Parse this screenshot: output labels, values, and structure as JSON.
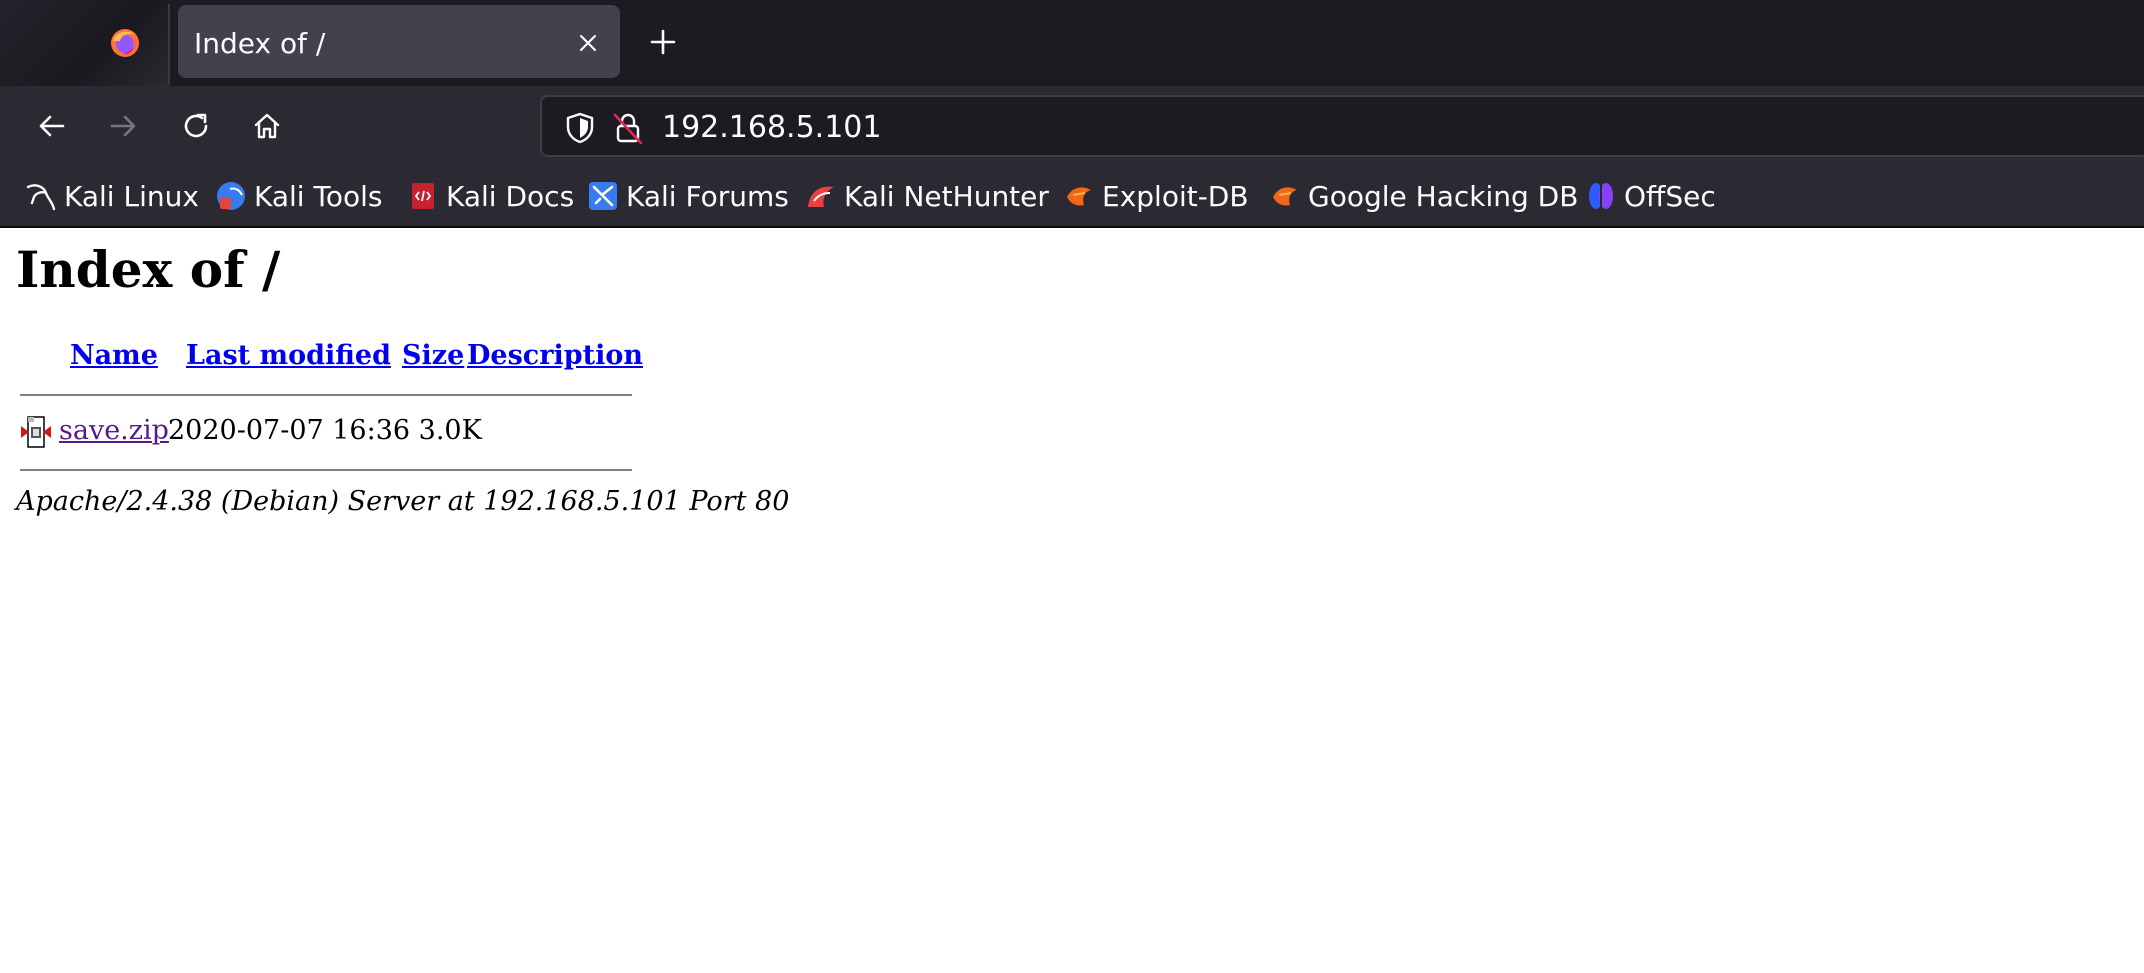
{
  "browser": {
    "tab": {
      "title": "Index of /"
    },
    "url": "192.168.5.101",
    "bookmarks": [
      {
        "label": "Kali Linux",
        "icon": "kali-dragon-icon"
      },
      {
        "label": "Kali Tools",
        "icon": "kali-tools-icon"
      },
      {
        "label": "Kali Docs",
        "icon": "kali-docs-icon"
      },
      {
        "label": "Kali Forums",
        "icon": "kali-forums-icon"
      },
      {
        "label": "Kali NetHunter",
        "icon": "kali-nethunter-icon"
      },
      {
        "label": "Exploit-DB",
        "icon": "exploit-db-icon"
      },
      {
        "label": "Google Hacking DB",
        "icon": "ghdb-icon"
      },
      {
        "label": "OffSec",
        "icon": "offsec-icon"
      }
    ],
    "colors": {
      "tabstrip": "#1c1b22",
      "toolbar": "#2b2a33",
      "active_tab": "#42414d",
      "text": "#fbfbfe"
    }
  },
  "page": {
    "title": "Index of /",
    "columns": {
      "name": "Name",
      "last_modified": "Last modified",
      "size": "Size",
      "description": "Description"
    },
    "files": [
      {
        "name": "save.zip",
        "last_modified": "2020-07-07 16:36",
        "size": "3.0K",
        "description": "",
        "icon": "compressed-file-icon"
      }
    ],
    "server_signature": "Apache/2.4.38 (Debian) Server at 192.168.5.101 Port 80",
    "colors": {
      "link": "#0000ee",
      "visited_link": "#551a8b"
    }
  }
}
